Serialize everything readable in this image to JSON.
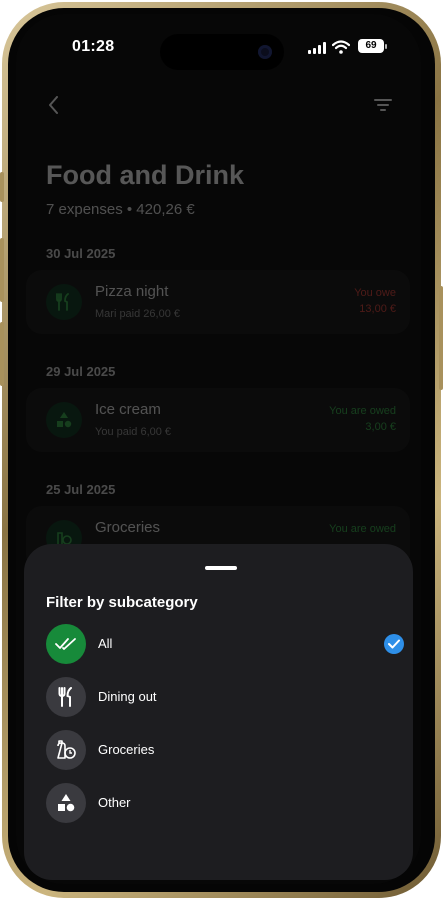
{
  "status_bar": {
    "time": "01:28",
    "battery": "69"
  },
  "header": {
    "title": "Food and Drink",
    "subtitle": "7 expenses • 420,26 €"
  },
  "groups": [
    {
      "date": "30 Jul 2025",
      "expense": {
        "name": "Pizza night",
        "paid": "Mari paid 26,00 €",
        "status": "You owe",
        "amount": "13,00 €",
        "icon": "fork-knife-icon"
      }
    },
    {
      "date": "29 Jul 2025",
      "expense": {
        "name": "Ice cream",
        "paid": "You paid 6,00 €",
        "status": "You are owed",
        "amount": "3,00 €",
        "icon": "shapes-icon"
      }
    },
    {
      "date": "25 Jul 2025",
      "expense": {
        "name": "Groceries",
        "paid": "",
        "status": "You are owed",
        "amount": "",
        "icon": "grocery-icon"
      }
    }
  ],
  "sheet": {
    "title": "Filter by subcategory",
    "options": [
      {
        "label": "All",
        "icon": "double-check-icon",
        "selected": true
      },
      {
        "label": "Dining out",
        "icon": "fork-knife-icon",
        "selected": false
      },
      {
        "label": "Groceries",
        "icon": "grocery-icon",
        "selected": false
      },
      {
        "label": "Other",
        "icon": "shapes-icon",
        "selected": false
      }
    ]
  },
  "colors": {
    "owe": "#e0433b",
    "owed": "#37b24d",
    "selected_icon_bg": "#178a3a",
    "check": "#2e8fe8",
    "sheet_bg": "#1d1d20"
  }
}
